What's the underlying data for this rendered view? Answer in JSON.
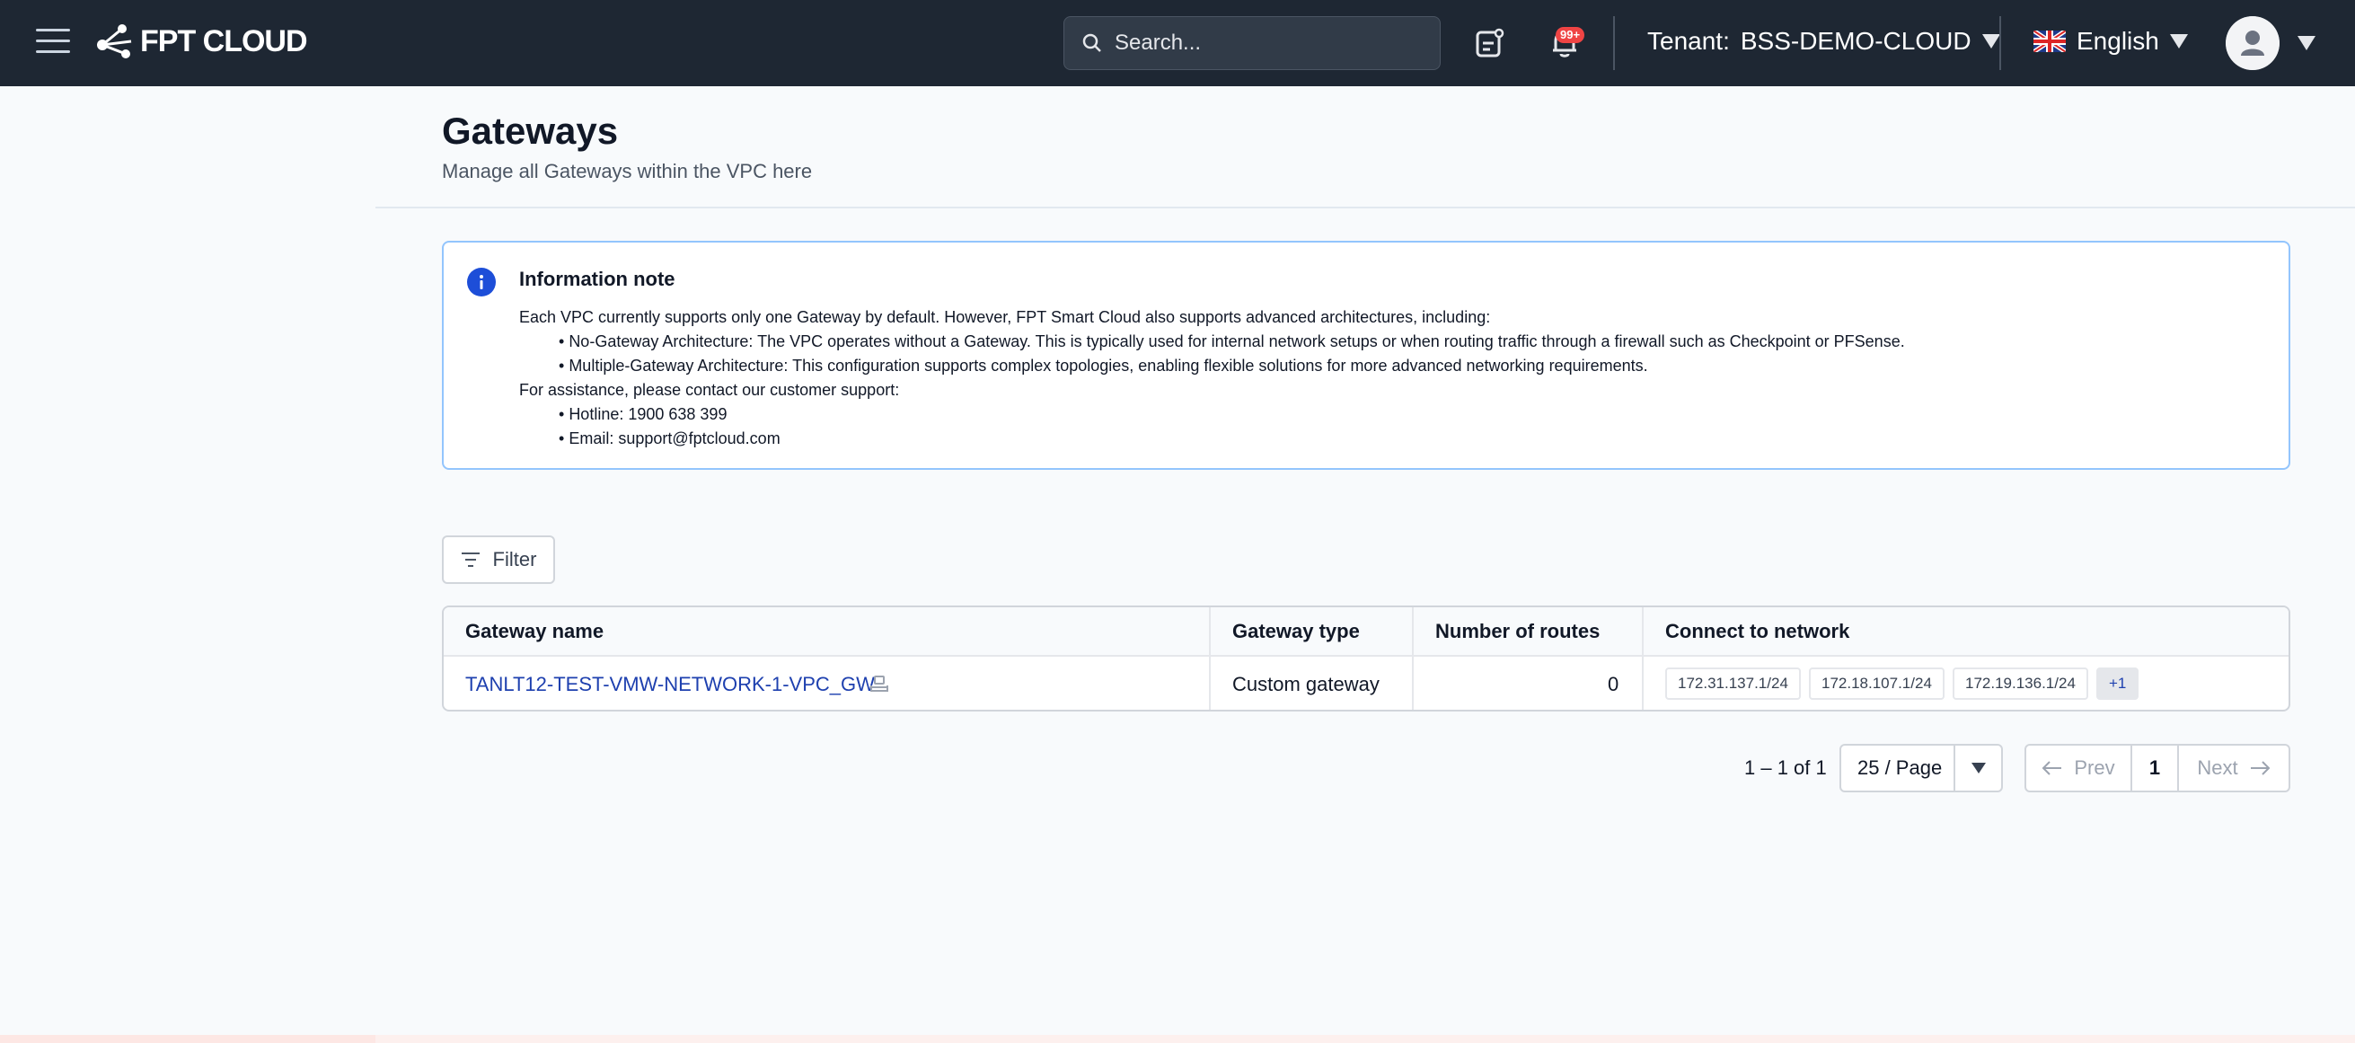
{
  "topbar": {
    "logo_text": "FPT CLOUD",
    "search_placeholder": "Search...",
    "notification_badge": "99+",
    "tenant_label": "Tenant:",
    "tenant_value": "BSS-DEMO-CLOUD",
    "language": "English"
  },
  "page": {
    "title": "Gateways",
    "subtitle": "Manage all Gateways within the VPC here"
  },
  "info_note": {
    "title": "Information note",
    "intro": "Each VPC currently supports only one Gateway by default. However, FPT Smart Cloud also supports advanced architectures, including:",
    "bullet_1": "No-Gateway Architecture: The VPC operates without a Gateway. This is typically used for internal network setups or when routing traffic through a firewall such as Checkpoint or PFSense.",
    "bullet_2": "Multiple-Gateway Architecture: This configuration supports complex topologies, enabling flexible solutions for more advanced networking requirements.",
    "support_intro": "For assistance, please contact our customer support:",
    "hotline": "Hotline: 1900 638 399",
    "email": "Email: support@fptcloud.com"
  },
  "filter": {
    "label": "Filter"
  },
  "table": {
    "columns": [
      "Gateway name",
      "Gateway type",
      "Number of routes",
      "Connect to network"
    ],
    "rows": [
      {
        "name": "TANLT12-TEST-VMW-NETWORK-1-VPC_GW",
        "type": "Custom gateway",
        "routes": "0",
        "networks": [
          "172.31.137.1/24",
          "172.18.107.1/24",
          "172.19.136.1/24"
        ],
        "more": "+1"
      }
    ]
  },
  "pagination": {
    "range": "1 – 1 of 1",
    "page_size": "25 / Page",
    "prev": "Prev",
    "current": "1",
    "next": "Next"
  },
  "colors": {
    "topbar_bg": "#1e2733",
    "accent_link": "#1e40af",
    "info_border": "#93c5fd",
    "badge": "#ef4444"
  }
}
